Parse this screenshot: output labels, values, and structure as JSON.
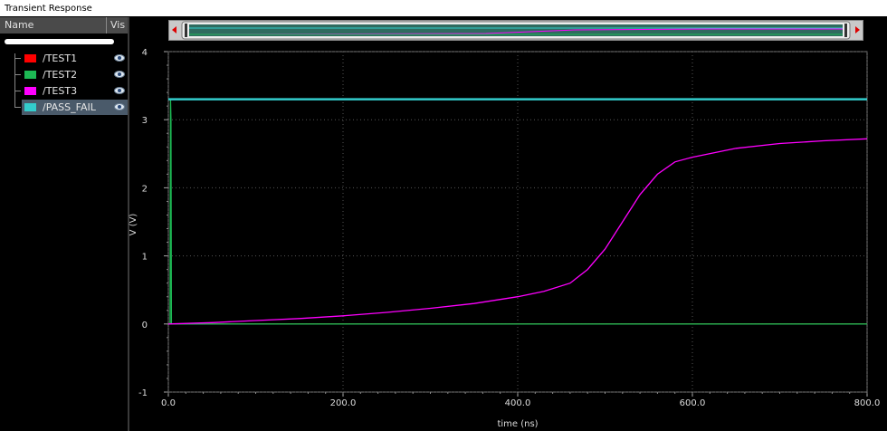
{
  "window": {
    "title": "Transient Response"
  },
  "sidebar": {
    "header_name": "Name",
    "header_vis": "Vis",
    "signals": [
      {
        "label": "/TEST1",
        "color": "#ff0000",
        "visible_icon": "eye-icon",
        "selected": false
      },
      {
        "label": "/TEST2",
        "color": "#1db954",
        "visible_icon": "eye-icon",
        "selected": false
      },
      {
        "label": "/TEST3",
        "color": "#ff00ff",
        "visible_icon": "eye-icon",
        "selected": false
      },
      {
        "label": "/PASS_FAIL",
        "color": "#33cccc",
        "visible_icon": "eye-icon",
        "selected": true
      }
    ]
  },
  "overview": {
    "left_arrow_icon": "left-arrow-icon",
    "right_arrow_icon": "right-arrow-icon"
  },
  "chart_data": {
    "type": "line",
    "xlabel": "time (ns)",
    "ylabel": "V (V)",
    "xlim": [
      0,
      800
    ],
    "ylim": [
      -1,
      4
    ],
    "x_ticks": [
      "0.0",
      "200.0",
      "400.0",
      "600.0",
      "800.0"
    ],
    "y_ticks": [
      "-1",
      "0",
      "1",
      "2",
      "3",
      "4"
    ],
    "grid": true,
    "series": [
      {
        "name": "/TEST1",
        "color": "#ff0000",
        "x": [
          0,
          800
        ],
        "y": [
          0,
          0
        ]
      },
      {
        "name": "/TEST2",
        "color": "#1db954",
        "x": [
          0,
          2,
          2.5,
          3,
          3.5,
          800
        ],
        "y": [
          0,
          0,
          3.3,
          3.0,
          0,
          0
        ]
      },
      {
        "name": "/TEST3",
        "color": "#ff00ff",
        "x": [
          0,
          50,
          100,
          150,
          200,
          250,
          300,
          350,
          400,
          430,
          460,
          480,
          500,
          520,
          540,
          560,
          580,
          600,
          650,
          700,
          750,
          800
        ],
        "y": [
          0,
          0.02,
          0.05,
          0.08,
          0.12,
          0.17,
          0.23,
          0.3,
          0.4,
          0.48,
          0.6,
          0.8,
          1.1,
          1.5,
          1.9,
          2.2,
          2.38,
          2.45,
          2.58,
          2.65,
          2.69,
          2.72
        ]
      },
      {
        "name": "/PASS_FAIL",
        "color": "#33cccc",
        "x": [
          0,
          800
        ],
        "y": [
          3.3,
          3.3
        ]
      }
    ]
  }
}
